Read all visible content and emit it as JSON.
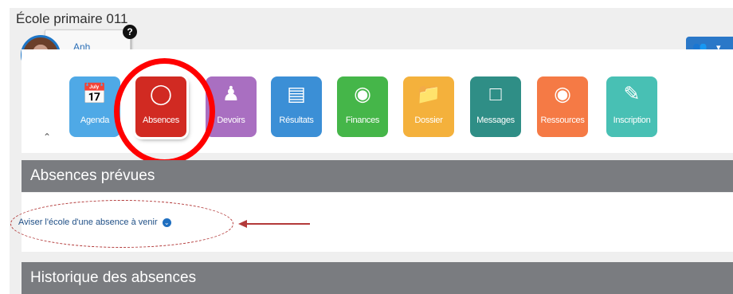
{
  "school": {
    "name": "École primaire 011"
  },
  "user": {
    "name": "Anh"
  },
  "help_badge": "?",
  "users_menu": {
    "icon": "users-group-icon",
    "caret": "▾"
  },
  "tiles": [
    {
      "label": "Agenda",
      "icon": "calendar-icon",
      "color": "#4fa9e6"
    },
    {
      "label": "Absences",
      "icon": "absence-person-icon",
      "color": "#d12a22"
    },
    {
      "label": "Devoirs",
      "icon": "person-book-icon",
      "color": "#a96fc1"
    },
    {
      "label": "Résultats",
      "icon": "bar-chart-icon",
      "color": "#3b8fd6"
    },
    {
      "label": "Finances",
      "icon": "dollar-coin-icon",
      "color": "#45b649"
    },
    {
      "label": "Dossier",
      "icon": "folder-icon",
      "color": "#f4b13c"
    },
    {
      "label": "Messages",
      "icon": "note-message-icon",
      "color": "#2f8e86"
    },
    {
      "label": "Ressources",
      "icon": "hand-coin-icon",
      "color": "#f57a45"
    },
    {
      "label": "Inscription",
      "icon": "form-edit-icon",
      "color": "#48c0b4"
    }
  ],
  "sections": {
    "planned": {
      "title": "Absences prévues",
      "link": "Aviser l'école d'une absence à venir"
    },
    "history": {
      "title": "Historique des absences"
    }
  },
  "colors": {
    "header_bg": "#7a7c80",
    "highlight": "#ff0000",
    "annotation": "#b33a3a"
  }
}
